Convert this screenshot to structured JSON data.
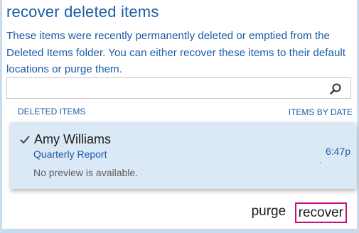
{
  "dialog": {
    "title": "recover deleted items",
    "description": "These items were recently permanently deleted or emptied from the Deleted Items folder. You can either recover these items to their default locations or purge them."
  },
  "search": {
    "placeholder": "",
    "value": "",
    "icon": "search-icon"
  },
  "list": {
    "header_left": "DELETED ITEMS",
    "header_right": "ITEMS BY DATE",
    "items": [
      {
        "sender": "Amy Williams",
        "subject": "Quarterly Report",
        "time": "6:47p",
        "preview": "No preview is available.",
        "checked": true
      }
    ]
  },
  "footer": {
    "purge_label": "purge",
    "recover_label": "recover"
  },
  "colors": {
    "accent": "#1a5ca7",
    "selected_row": "#dbe8f6",
    "highlight_border": "#c5107c",
    "frame": "#c9dcee"
  }
}
